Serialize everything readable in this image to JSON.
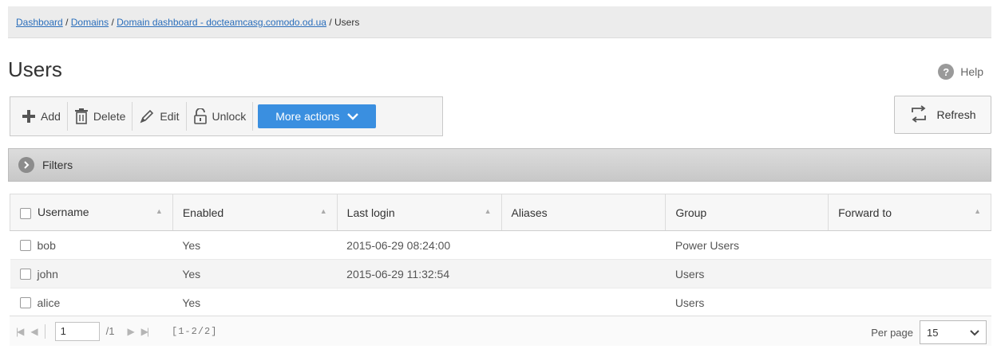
{
  "breadcrumb": {
    "items": [
      "Dashboard",
      "Domains",
      "Domain dashboard - docteamcasg.comodo.od.ua"
    ],
    "current": "Users",
    "separator": "/"
  },
  "page": {
    "title": "Users"
  },
  "help": {
    "label": "Help",
    "icon": "question-icon"
  },
  "toolbar": {
    "add": "Add",
    "delete": "Delete",
    "edit": "Edit",
    "unlock": "Unlock",
    "more_actions": "More actions",
    "accent_color": "#3a8fe0"
  },
  "refresh": {
    "label": "Refresh"
  },
  "filters": {
    "label": "Filters"
  },
  "table": {
    "columns": [
      "Username",
      "Enabled",
      "Last login",
      "Aliases",
      "Group",
      "Forward to"
    ],
    "rows": [
      {
        "username": "bob",
        "enabled": "Yes",
        "last_login": "2015-06-29 08:24:00",
        "aliases": "",
        "group": "Power Users",
        "forward_to": ""
      },
      {
        "username": "john",
        "enabled": "Yes",
        "last_login": "2015-06-29 11:32:54",
        "aliases": "",
        "group": "Users",
        "forward_to": ""
      },
      {
        "username": "alice",
        "enabled": "Yes",
        "last_login": "",
        "aliases": "",
        "group": "Users",
        "forward_to": ""
      }
    ]
  },
  "pager": {
    "page": "1",
    "total_pages": "/1",
    "range": "[1-2/2]",
    "per_page_label": "Per page",
    "per_page_value": "15"
  }
}
